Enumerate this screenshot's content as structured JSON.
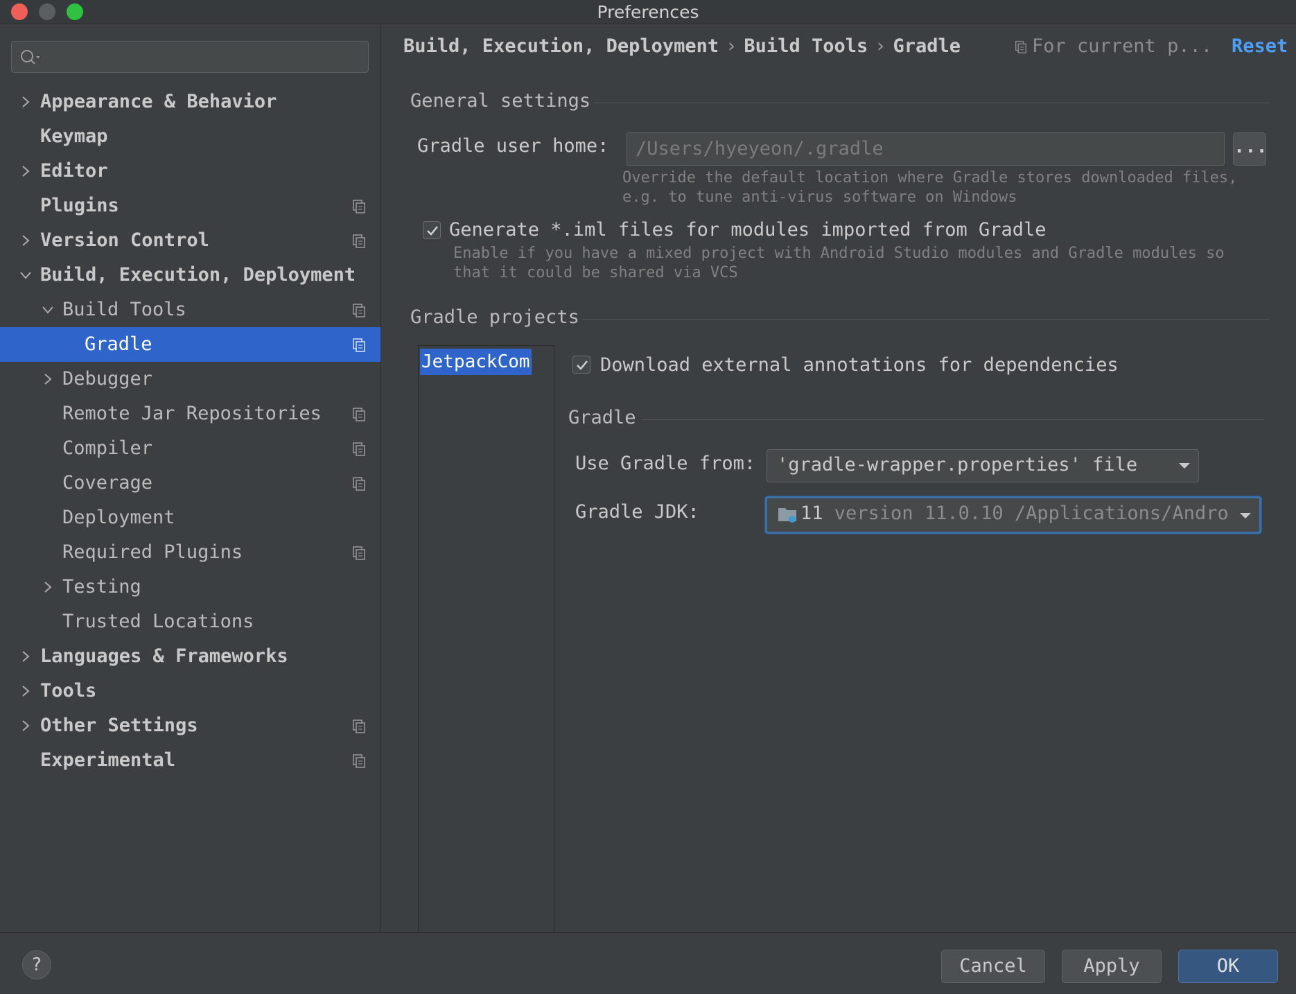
{
  "window": {
    "title": "Preferences"
  },
  "sidebar": {
    "search_placeholder": "",
    "items": [
      {
        "label": "Appearance & Behavior"
      },
      {
        "label": "Keymap"
      },
      {
        "label": "Editor"
      },
      {
        "label": "Plugins"
      },
      {
        "label": "Version Control"
      },
      {
        "label": "Build, Execution, Deployment"
      },
      {
        "label": "Build Tools"
      },
      {
        "label": "Gradle"
      },
      {
        "label": "Debugger"
      },
      {
        "label": "Remote Jar Repositories"
      },
      {
        "label": "Compiler"
      },
      {
        "label": "Coverage"
      },
      {
        "label": "Deployment"
      },
      {
        "label": "Required Plugins"
      },
      {
        "label": "Testing"
      },
      {
        "label": "Trusted Locations"
      },
      {
        "label": "Languages & Frameworks"
      },
      {
        "label": "Tools"
      },
      {
        "label": "Other Settings"
      },
      {
        "label": "Experimental"
      }
    ],
    "selected": "Gradle"
  },
  "header": {
    "breadcrumb": [
      "Build, Execution, Deployment",
      "Build Tools",
      "Gradle"
    ],
    "scope_label": "For current p...",
    "reset_label": "Reset"
  },
  "general": {
    "title": "General settings",
    "user_home_label": "Gradle user home:",
    "user_home_value": "/Users/hyeyeon/.gradle",
    "browse_label": "...",
    "user_home_hint_1": "Override the default location where Gradle stores downloaded files,",
    "user_home_hint_2": "e.g. to tune anti-virus software on Windows",
    "generate_iml_label": "Generate *.iml files for modules imported from Gradle",
    "generate_iml_checked": true,
    "generate_iml_hint_1": "Enable if you have a mixed project with Android Studio modules and Gradle modules so",
    "generate_iml_hint_2": "that it could be shared via VCS"
  },
  "projects": {
    "title": "Gradle projects",
    "list": [
      "JetpackCompos"
    ],
    "download_annotations_label": "Download external annotations for dependencies",
    "download_annotations_checked": true,
    "gradle_section_title": "Gradle",
    "use_gradle_from_label": "Use Gradle from:",
    "use_gradle_from_value": "'gradle-wrapper.properties' file",
    "jdk_label": "Gradle JDK:",
    "jdk_version": "11",
    "jdk_detail": "version 11.0.10 /Applications/Andro"
  },
  "footer": {
    "help_label": "?",
    "cancel_label": "Cancel",
    "apply_label": "Apply",
    "ok_label": "OK"
  },
  "colors": {
    "selection": "#2f65ca",
    "link": "#4b9ff7",
    "background": "#3c3f41"
  }
}
